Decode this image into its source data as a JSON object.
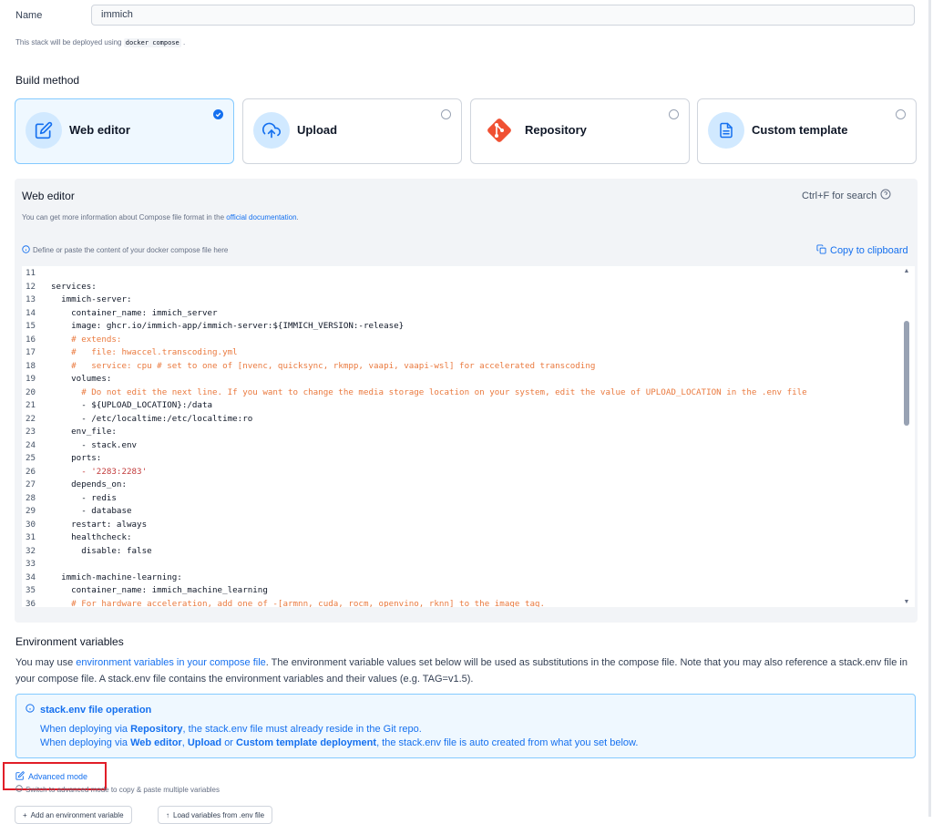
{
  "name_field": {
    "label": "Name",
    "value": "immich"
  },
  "deploy_note": {
    "text": "This stack will be deployed using",
    "code": "docker compose",
    "suffix": "."
  },
  "build_method": {
    "title": "Build method",
    "options": [
      {
        "label": "Web editor",
        "icon": "pencil-square-icon",
        "selected": true
      },
      {
        "label": "Upload",
        "icon": "cloud-upload-icon",
        "selected": false
      },
      {
        "label": "Repository",
        "icon": "git-icon",
        "selected": false
      },
      {
        "label": "Custom template",
        "icon": "file-text-icon",
        "selected": false
      }
    ]
  },
  "editor": {
    "title": "Web editor",
    "search_hint": "Ctrl+F for search",
    "info_prefix": "You can get more information about Compose file format in the",
    "info_link": "official documentation",
    "info_suffix": ".",
    "define_hint": "Define or paste the content of your docker compose file here",
    "copy_label": "Copy to clipboard",
    "lines": [
      {
        "n": "11",
        "t": ""
      },
      {
        "n": "12",
        "t": "services:"
      },
      {
        "n": "13",
        "t": "  immich-server:"
      },
      {
        "n": "14",
        "t": "    container_name: immich_server"
      },
      {
        "n": "15",
        "t": "    image: ghcr.io/immich-app/immich-server:${IMMICH_VERSION:-release}"
      },
      {
        "n": "16",
        "t": "    # extends:"
      },
      {
        "n": "17",
        "t": "    #   file: hwaccel.transcoding.yml"
      },
      {
        "n": "18",
        "t": "    #   service: cpu # set to one of [nvenc, quicksync, rkmpp, vaapi, vaapi-wsl] for accelerated transcoding"
      },
      {
        "n": "19",
        "t": "    volumes:"
      },
      {
        "n": "20",
        "t": "      # Do not edit the next line. If you want to change the media storage location on your system, edit the value of UPLOAD_LOCATION in the .env file"
      },
      {
        "n": "21",
        "t": "      - ${UPLOAD_LOCATION}:/data"
      },
      {
        "n": "22",
        "t": "      - /etc/localtime:/etc/localtime:ro"
      },
      {
        "n": "23",
        "t": "    env_file:"
      },
      {
        "n": "24",
        "t": "      - stack.env"
      },
      {
        "n": "25",
        "t": "    ports:"
      },
      {
        "n": "26",
        "t": "      - '2283:2283'"
      },
      {
        "n": "27",
        "t": "    depends_on:"
      },
      {
        "n": "28",
        "t": "      - redis"
      },
      {
        "n": "29",
        "t": "      - database"
      },
      {
        "n": "30",
        "t": "    restart: always"
      },
      {
        "n": "31",
        "t": "    healthcheck:"
      },
      {
        "n": "32",
        "t": "      disable: false"
      },
      {
        "n": "33",
        "t": ""
      },
      {
        "n": "34",
        "t": "  immich-machine-learning:"
      },
      {
        "n": "35",
        "t": "    container_name: immich_machine_learning"
      },
      {
        "n": "36",
        "t": "    # For hardware acceleration, add one of -[armnn, cuda, rocm, openvino, rknn] to the image tag."
      }
    ]
  },
  "env": {
    "title": "Environment variables",
    "desc_prefix": "You may use",
    "desc_link": "environment variables in your compose file",
    "desc_suffix": ". The environment variable values set below will be used as substitutions in the compose file. Note that you may also reference a stack.env file in your compose file. A stack.env file contains the environment variables and their values (e.g. TAG=v1.5).",
    "info_title": "stack.env file operation",
    "info_line1_a": "When deploying via",
    "info_line1_b": "Repository",
    "info_line1_c": ", the stack.env file must already reside in the Git repo.",
    "info_line2_a": "When deploying via",
    "info_line2_b": "Web editor",
    "info_line2_c": ",",
    "info_line2_d": "Upload",
    "info_line2_e": "or",
    "info_line2_f": "Custom template deployment",
    "info_line2_g": ", the stack.env file is auto created from what you set below.",
    "advanced_label": "Advanced mode",
    "advanced_hint": "Switch to advanced mode to copy & paste multiple variables",
    "add_button": "Add an environment variable",
    "load_button": "Load variables from .env file"
  },
  "colors": {
    "accent": "#1570ef",
    "comment": "#ea7a3f",
    "highlight": "#e11d28"
  }
}
